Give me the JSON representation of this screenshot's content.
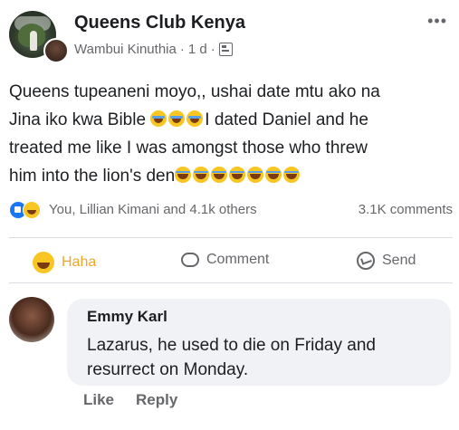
{
  "post": {
    "group_name": "Queens Club Kenya",
    "author": "Wambui Kinuthia",
    "separator": "·",
    "time": "1 d",
    "separator2": "·",
    "more_icon": "more-options-icon",
    "privacy_icon": "public-group-icon",
    "text_line1": "Queens tupeaneni moyo,, ushai date mtu ako na",
    "text_line2a": "Jina iko kwa Bible ",
    "text_line2b": "I dated Daniel and he",
    "text_line3": "treated me like I was amongst those who threw",
    "text_line4": "him into the lion's den"
  },
  "reactions": {
    "types": [
      "like",
      "haha"
    ],
    "summary": "You, Lillian Kimani and 4.1k others",
    "comments_count": "3.1K comments"
  },
  "actions": {
    "haha_label": "Haha",
    "comment_label": "Comment",
    "send_label": "Send"
  },
  "comment": {
    "author": "Emmy Karl",
    "text": "Lazarus, he used to die on Friday and resurrect on Monday.",
    "like_label": "Like",
    "reply_label": "Reply"
  },
  "colors": {
    "haha_active": "#f0a52b",
    "like_blue": "#1877f2",
    "secondary_text": "#65676b",
    "bubble_bg": "#f0f2f5"
  }
}
